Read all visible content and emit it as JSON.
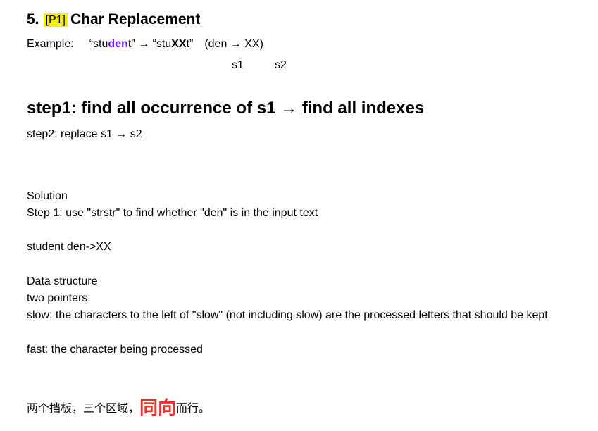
{
  "heading": {
    "number": "5.",
    "tag": "[P1]",
    "title": "Char Replacement"
  },
  "example": {
    "label": "Example:",
    "q1_open": "“stu",
    "q1_highlight": "den",
    "q1_close": "t”",
    "arrow": "→",
    "q2_open": "“stu",
    "q2_bold": "XX",
    "q2_close": "t”",
    "mapping": "(den → XX)",
    "s1_label": "s1",
    "s2_label": "s2"
  },
  "step1": "step1: find all occurrence of s1 → find all indexes",
  "step2": "step2: replace s1 → s2",
  "solution": {
    "title": "Solution",
    "step": "Step 1: use \"strstr\" to find whether \"den\" is in the input text",
    "example": "student den->XX"
  },
  "data_structure": {
    "title": "Data structure",
    "pointers": "two pointers:",
    "slow": "slow: the characters to the left of \"slow\" (not including slow) are the processed letters that should be kept",
    "fast": "fast: the character being processed"
  },
  "chinese": {
    "prefix": "两个挡板，三个区域，",
    "emphasis": "同向",
    "suffix": "而行。"
  },
  "colors": {
    "tag_highlight": "#f5f200",
    "purple": "#6a1cff",
    "red": "#e8322c"
  }
}
